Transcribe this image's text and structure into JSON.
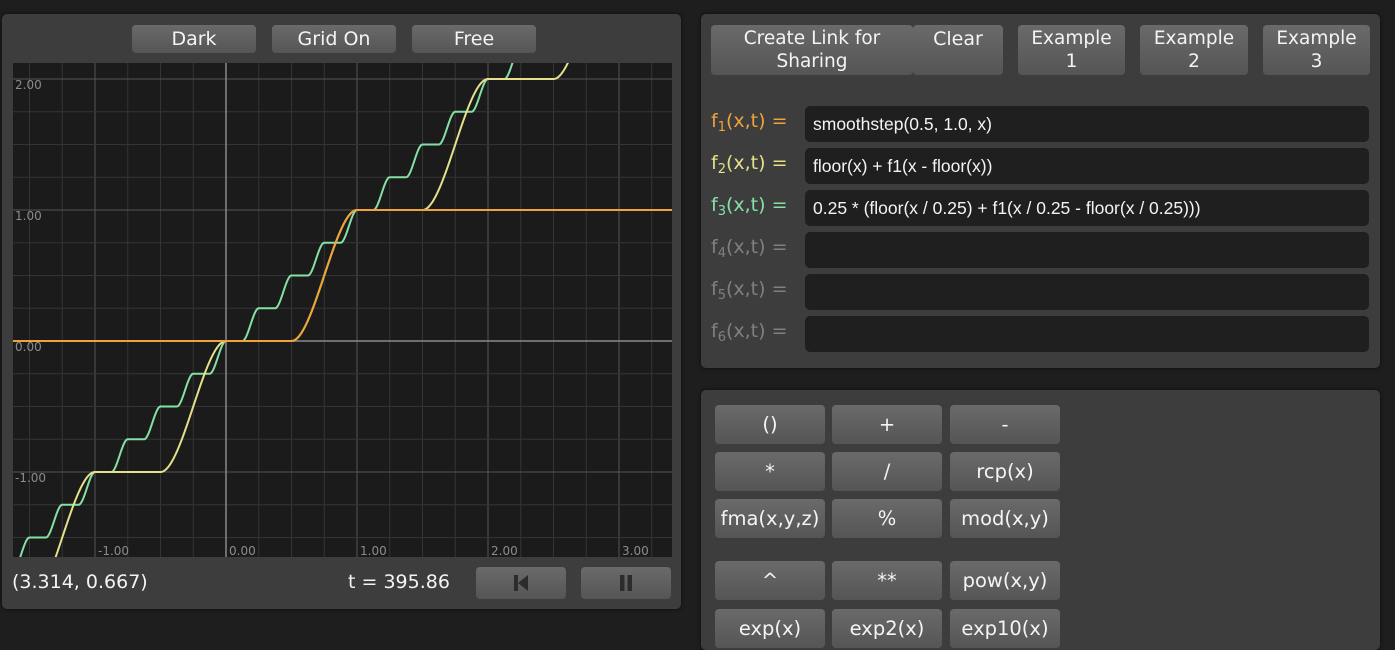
{
  "plot_panel": {
    "controls": {
      "theme": "Dark",
      "grid": "Grid On",
      "mode": "Free"
    },
    "axis_labels": {
      "x": [
        "-1.00",
        "0.00",
        "1.00",
        "2.00",
        "3.00"
      ],
      "y": [
        "2.00",
        "1.00",
        "0.00",
        "-1.00"
      ]
    },
    "cursor_coords": "(3.314, 0.667)",
    "time_readout": "t = 395.86",
    "icons": {
      "rewind": "skip-back-icon",
      "pause": "pause-icon"
    },
    "curves": {
      "f1_color": "#f0a33a",
      "f2_color": "#e5e08a",
      "f3_color": "#86e0a6"
    }
  },
  "functions_panel": {
    "share_button": "Create Link for\nSharing",
    "clear_button": "Clear",
    "examples": [
      "Example\n1",
      "Example\n2",
      "Example\n3"
    ],
    "rows": [
      {
        "name": "f",
        "sub": "1",
        "args": "(x,t) =",
        "value": "smoothstep(0.5, 1.0, x)",
        "color": "#f0a33a"
      },
      {
        "name": "f",
        "sub": "2",
        "args": "(x,t) =",
        "value": "floor(x) + f1(x - floor(x))",
        "color": "#e5e08a"
      },
      {
        "name": "f",
        "sub": "3",
        "args": "(x,t) =",
        "value": "0.25 * (floor(x / 0.25) + f1(x / 0.25 - floor(x / 0.25)))",
        "color": "#86e0a6"
      },
      {
        "name": "f",
        "sub": "4",
        "args": "(x,t) =",
        "value": "",
        "color": "#808080"
      },
      {
        "name": "f",
        "sub": "5",
        "args": "(x,t) =",
        "value": "",
        "color": "#808080"
      },
      {
        "name": "f",
        "sub": "6",
        "args": "(x,t) =",
        "value": "",
        "color": "#808080"
      }
    ]
  },
  "calculator": {
    "buttons": [
      [
        "()",
        "+",
        "-"
      ],
      [
        "*",
        "/",
        "rcp(x)"
      ],
      [
        "fma(x,y,z)",
        "%",
        "mod(x,y)"
      ],
      [
        "^",
        "**",
        "pow(x,y)"
      ],
      [
        "exp(x)",
        "exp2(x)",
        "exp10(x)"
      ]
    ]
  }
}
